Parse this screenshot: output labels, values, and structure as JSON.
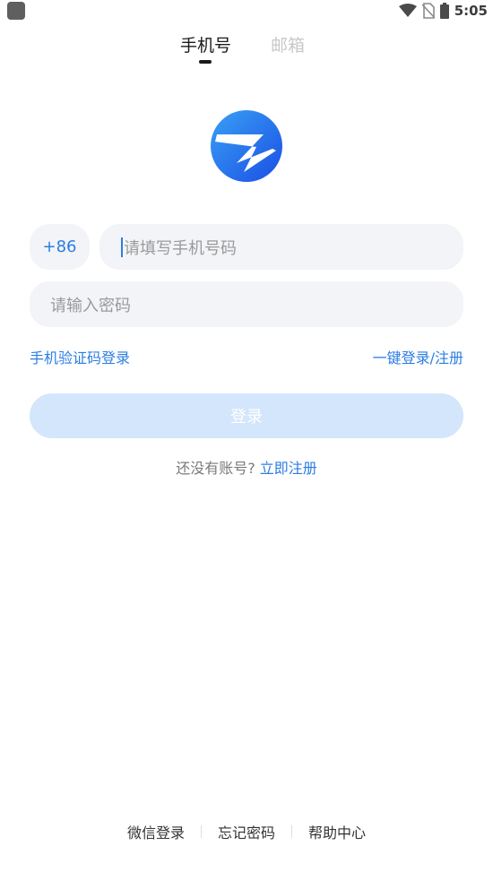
{
  "status_bar": {
    "time": "5:05",
    "icons": [
      "app-indicator",
      "wifi-icon",
      "no-sim-icon",
      "battery-icon"
    ]
  },
  "tabs": [
    {
      "label": "手机号",
      "active": true
    },
    {
      "label": "邮箱",
      "active": false
    }
  ],
  "logo": {
    "icon": "app-logo-icon",
    "colors": [
      "#2f8bf0",
      "#1f5be8"
    ]
  },
  "phone": {
    "country_code": "+86",
    "placeholder": "请填写手机号码"
  },
  "password": {
    "placeholder": "请输入密码"
  },
  "links": {
    "sms_login": "手机验证码登录",
    "one_key_login": "一键登录/注册"
  },
  "login_button": {
    "label": "登录",
    "enabled": false
  },
  "register": {
    "prompt": "还没有账号?",
    "link": "立即注册"
  },
  "footer": {
    "wechat_login": "微信登录",
    "forgot_password": "忘记密码",
    "help_center": "帮助中心"
  },
  "colors": {
    "accent": "#2b7de3",
    "button_disabled": "#d3e6fb",
    "field_bg": "#f2f4f7"
  }
}
